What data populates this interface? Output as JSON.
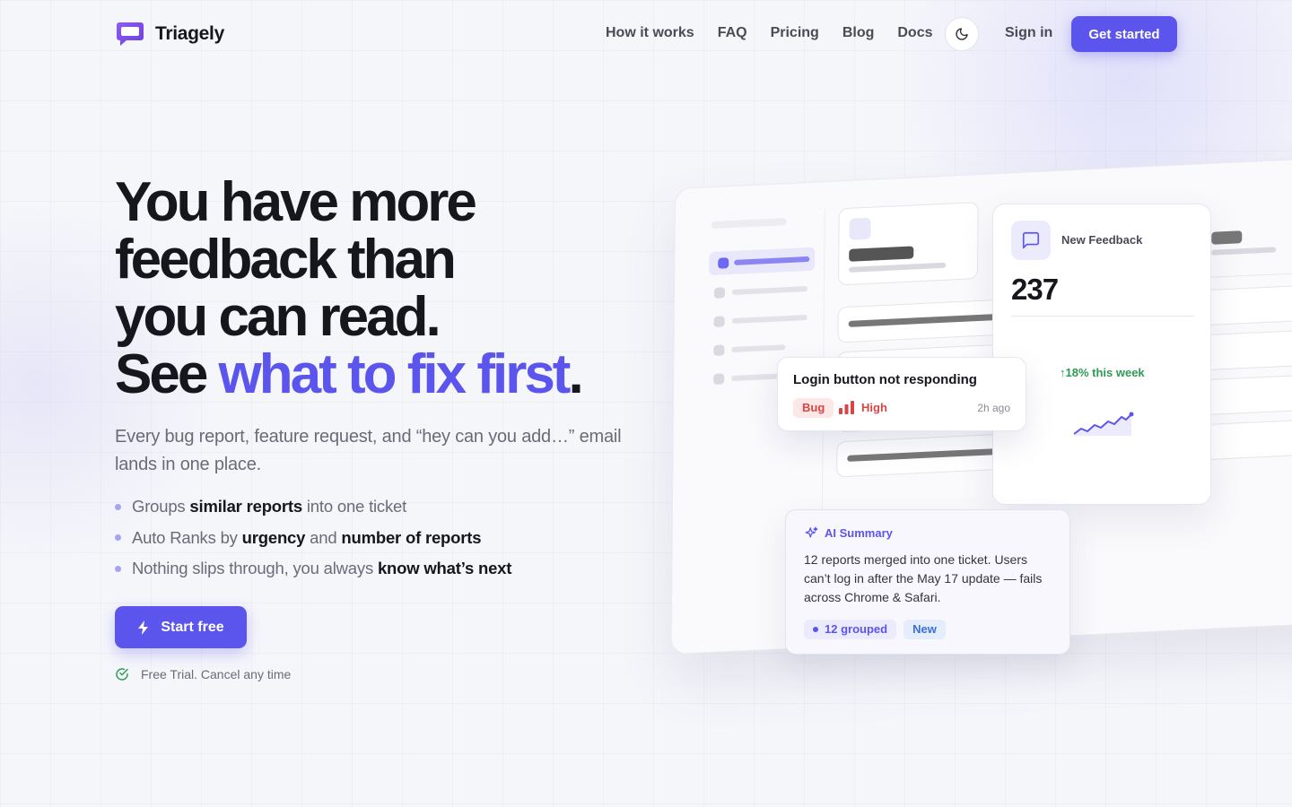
{
  "brand": {
    "name": "Triagely",
    "accent": "#5b55ee"
  },
  "nav": {
    "links": [
      "How it works",
      "FAQ",
      "Pricing",
      "Blog",
      "Docs"
    ],
    "theme_icon": "moon-icon",
    "signin": "Sign in",
    "cta": "Get started"
  },
  "hero": {
    "headline_lines": [
      "You have more",
      "feedback than",
      "you can read."
    ],
    "headline_see": "See ",
    "headline_accent": "what to fix first",
    "headline_end": ".",
    "subtext": "Every bug report, feature request, and “hey can you add…” email lands in one place.",
    "bullets": [
      {
        "pre": "Groups ",
        "bold": "similar reports",
        "mid": " into one ticket",
        "bold2": ""
      },
      {
        "pre": "Auto Ranks by ",
        "bold": "urgency",
        "mid": " and ",
        "bold2": "number of reports"
      },
      {
        "pre": "Nothing slips through, you always ",
        "bold": "know what’s next",
        "mid": "",
        "bold2": ""
      }
    ],
    "cta": "Start free",
    "trial_note": "Free Trial. Cancel any time"
  },
  "mock": {
    "feedback_card": {
      "label": "New Feedback",
      "count": "237",
      "trend": "↑18% this week",
      "trend_color": "#2f9a53"
    },
    "ticket_card": {
      "title": "Login button not responding",
      "tag": "Bug",
      "priority": "High",
      "time": "2h ago",
      "priority_color": "#d84545"
    },
    "ai_card": {
      "title": "AI Summary",
      "body": "12 reports merged into one ticket. Users can’t log in after the May 17 update — fails across Chrome & Safari.",
      "chip_grouped": "12 grouped",
      "chip_new": "New"
    }
  }
}
